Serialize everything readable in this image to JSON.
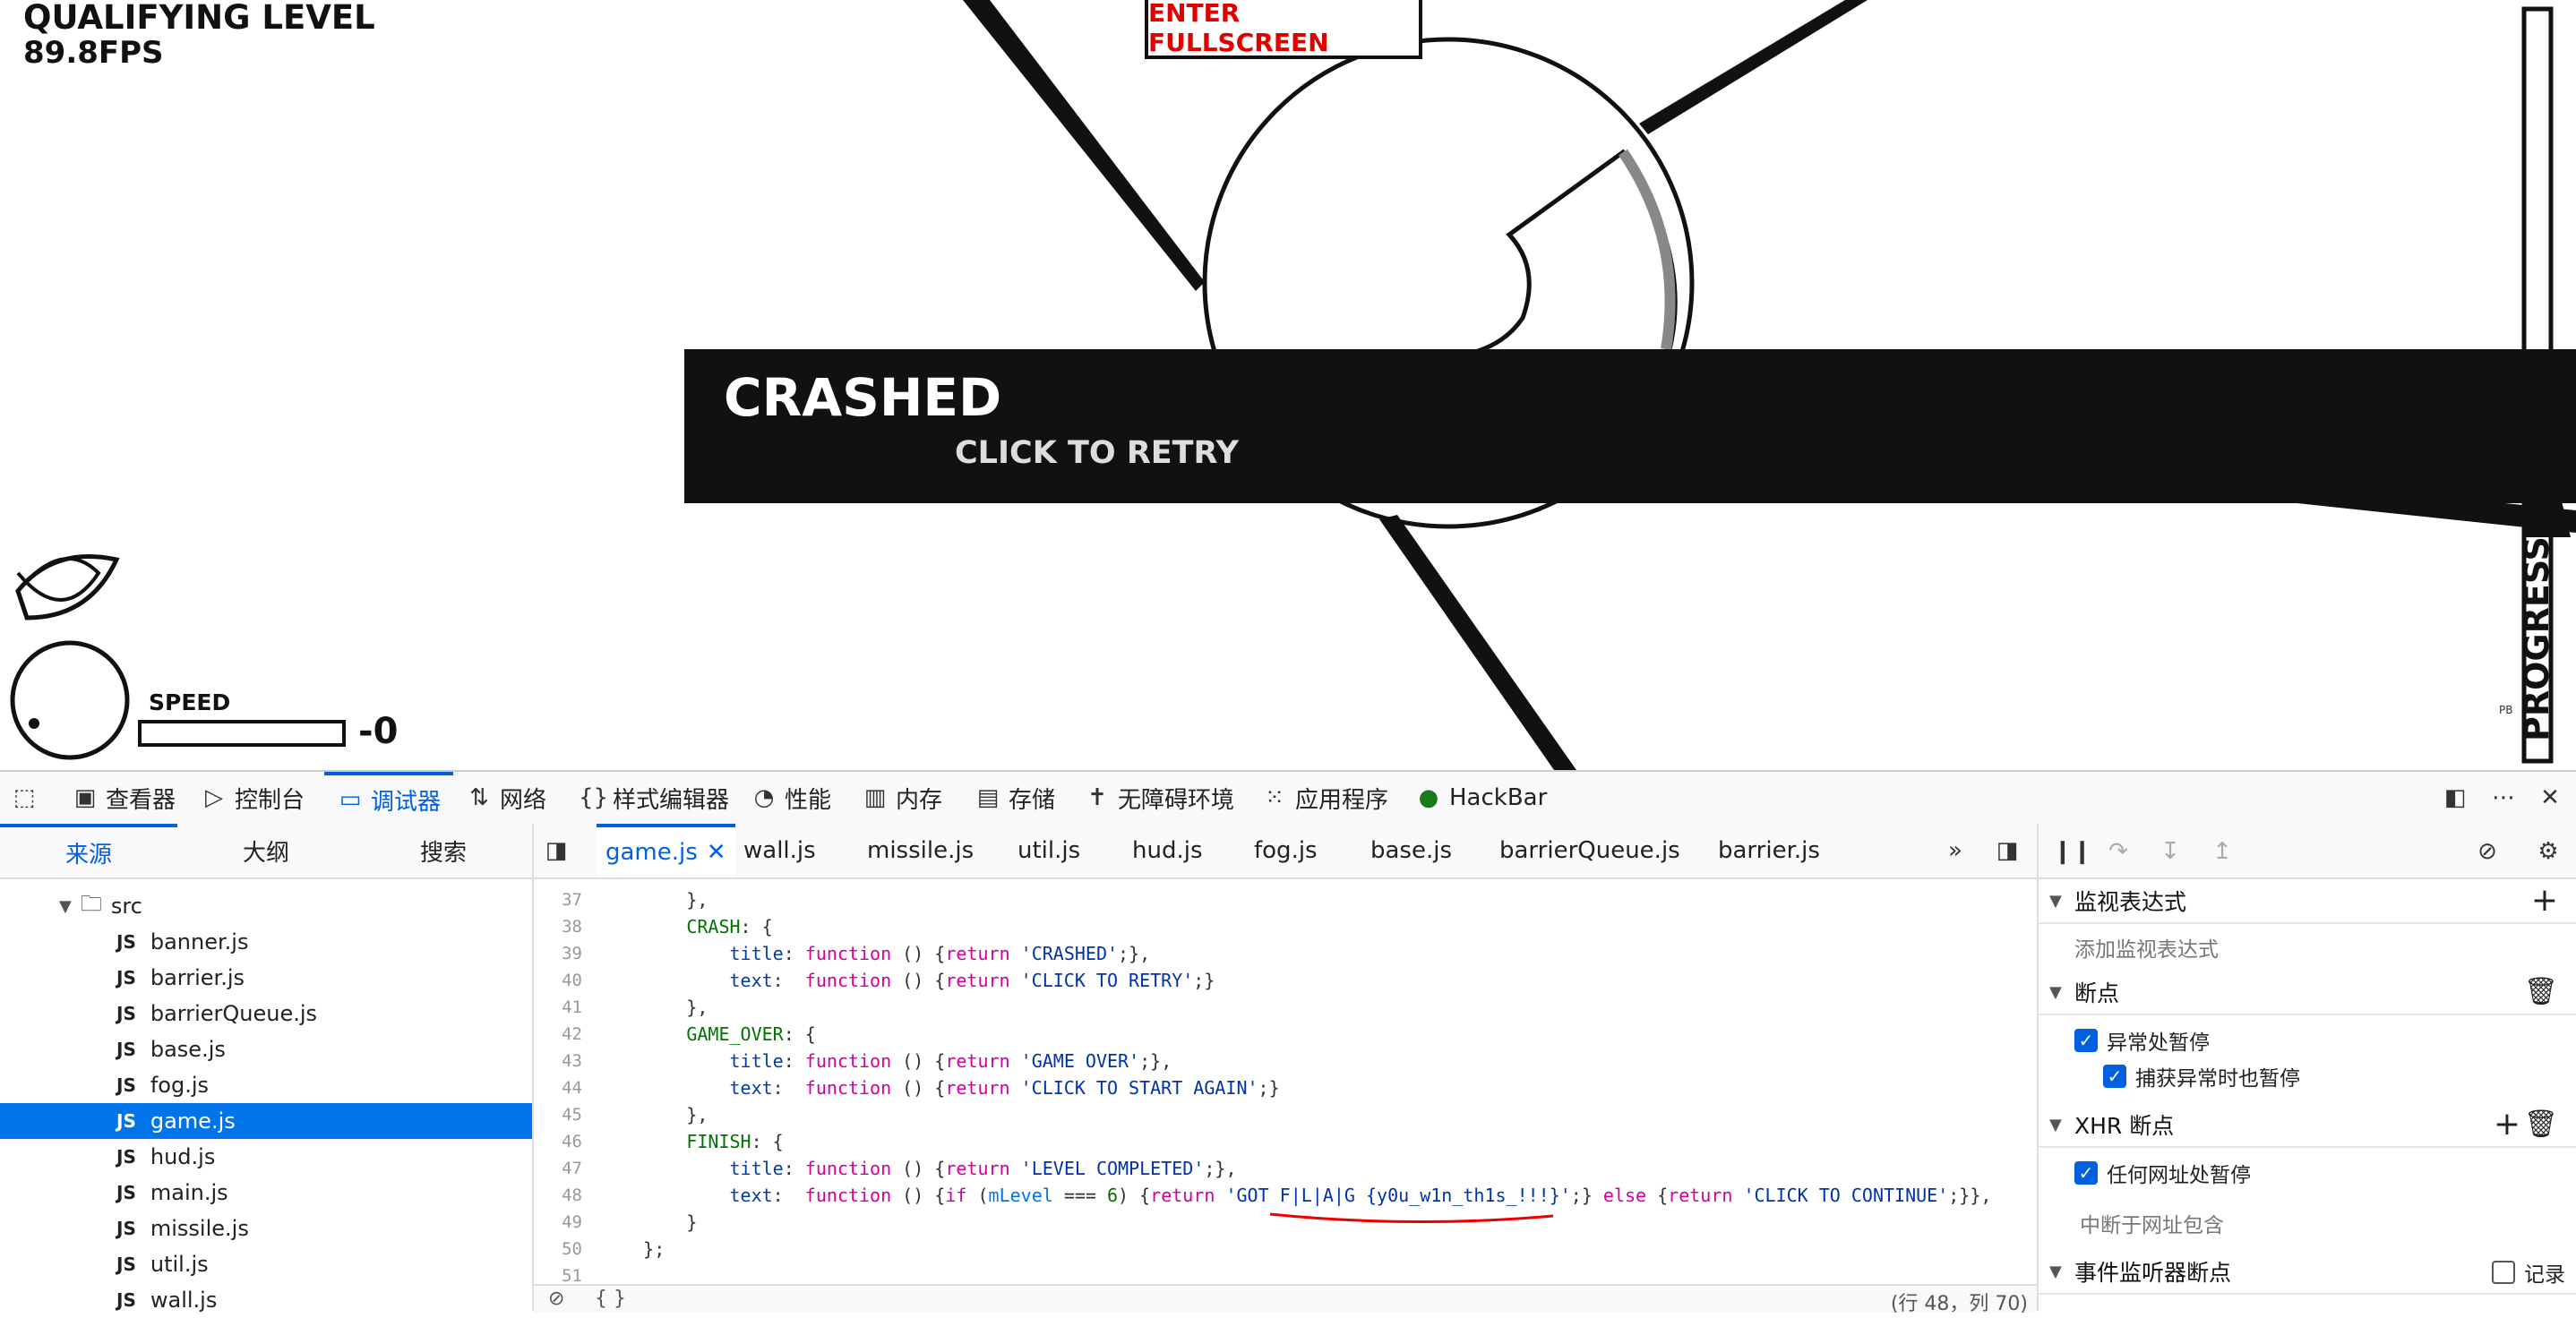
{
  "game": {
    "level_title": "QUALIFYING LEVEL",
    "fps": "89.8FPS",
    "fullscreen_label": "ENTER FULLSCREEN",
    "banner_title": "CRASHED",
    "banner_subtitle": "CLICK TO RETRY",
    "speed_label": "SPEED",
    "speed_value": "-0",
    "progress_label": "PROGRESS",
    "pb_label": "PB"
  },
  "devtools": {
    "tabs": [
      {
        "label": "查看器",
        "icon": "inspector-icon"
      },
      {
        "label": "控制台",
        "icon": "console-icon"
      },
      {
        "label": "调试器",
        "icon": "debugger-icon"
      },
      {
        "label": "网络",
        "icon": "network-icon"
      },
      {
        "label": "样式编辑器",
        "icon": "style-editor-icon"
      },
      {
        "label": "性能",
        "icon": "performance-icon"
      },
      {
        "label": "内存",
        "icon": "memory-icon"
      },
      {
        "label": "存储",
        "icon": "storage-icon"
      },
      {
        "label": "无障碍环境",
        "icon": "accessibility-icon"
      },
      {
        "label": "应用程序",
        "icon": "application-icon"
      },
      {
        "label": "HackBar",
        "icon": "hackbar-icon"
      }
    ],
    "active_tab": "调试器",
    "left_tabs": [
      "来源",
      "大纲",
      "搜索"
    ],
    "tree_folder": "src",
    "tree_files": [
      "banner.js",
      "barrier.js",
      "barrierQueue.js",
      "base.js",
      "fog.js",
      "game.js",
      "hud.js",
      "main.js",
      "missile.js",
      "util.js",
      "wall.js"
    ],
    "selected_file": "game.js",
    "js_badge": "JS",
    "editor_tabs": [
      "game.js",
      "wall.js",
      "missile.js",
      "util.js",
      "hud.js",
      "fog.js",
      "base.js",
      "barrierQueue.js",
      "barrier.js"
    ],
    "code_lines": [
      {
        "n": "37",
        "html": "        },"
      },
      {
        "n": "38",
        "html": "        <span class=\"key\">CRASH</span>: {"
      },
      {
        "n": "39",
        "html": "            <span class=\"prop\">title</span>: <span class=\"kw\">function</span> () {<span class=\"kw\">return</span> <span class=\"str\">'CRASHED'</span>;},"
      },
      {
        "n": "40",
        "html": "            <span class=\"prop\">text</span>:  <span class=\"kw\">function</span> () {<span class=\"kw\">return</span> <span class=\"str\">'CLICK TO RETRY'</span>;}"
      },
      {
        "n": "41",
        "html": "        },"
      },
      {
        "n": "42",
        "html": "        <span class=\"key\">GAME_OVER</span>: {"
      },
      {
        "n": "43",
        "html": "            <span class=\"prop\">title</span>: <span class=\"kw\">function</span> () {<span class=\"kw\">return</span> <span class=\"str\">'GAME OVER'</span>;},"
      },
      {
        "n": "44",
        "html": "            <span class=\"prop\">text</span>:  <span class=\"kw\">function</span> () {<span class=\"kw\">return</span> <span class=\"str\">'CLICK TO START AGAIN'</span>;}"
      },
      {
        "n": "45",
        "html": "        },"
      },
      {
        "n": "46",
        "html": "        <span class=\"key\">FINISH</span>: {"
      },
      {
        "n": "47",
        "html": "            <span class=\"prop\">title</span>: <span class=\"kw\">function</span> () {<span class=\"kw\">return</span> <span class=\"str\">'LEVEL COMPLETED'</span>;},"
      },
      {
        "n": "48",
        "html": "            <span class=\"prop\">text</span>:  <span class=\"kw\">function</span> () {<span class=\"kw\">if</span> (<span class=\"var\">mLevel</span> === <span class=\"num\">6</span>) {<span class=\"kw\">return</span> <span class=\"str\">'GOT F|L|A|G {y0u_w1n_th1s_!!!}'</span>;} <span class=\"kw\">else</span> {<span class=\"kw\">return</span> <span class=\"str\">'CLICK TO CONTINUE'</span>;}},"
      },
      {
        "n": "49",
        "html": "        }"
      },
      {
        "n": "50",
        "html": "    };"
      },
      {
        "n": "51",
        "html": ""
      }
    ],
    "status_left": "{ }",
    "status_right": "(行 48，列 70)",
    "right": {
      "watch_title": "监视表达式",
      "watch_placeholder": "添加监视表达式",
      "breakpoints_title": "断点",
      "pause_on_exceptions": "异常处暂停",
      "pause_on_caught": "捕获异常时也暂停",
      "xhr_title": "XHR 断点",
      "xhr_any": "任何网址处暂停",
      "xhr_contains": "中断于网址包含",
      "event_title": "事件监听器断点",
      "event_log": "记录"
    }
  }
}
